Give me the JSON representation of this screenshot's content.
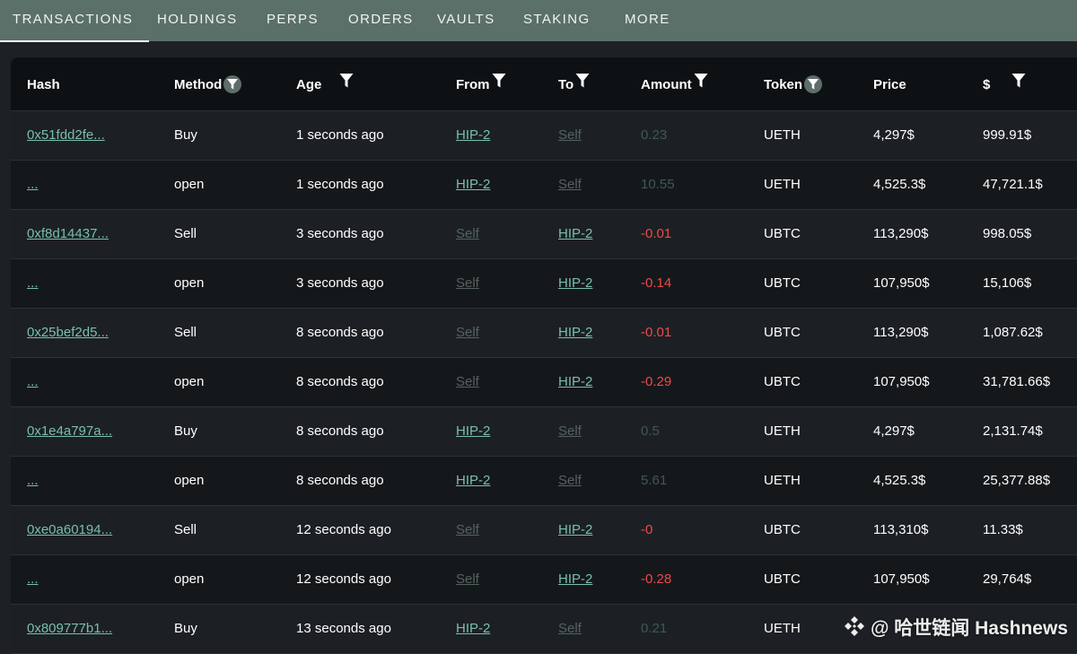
{
  "tabs": [
    {
      "label": "TRANSACTIONS",
      "active": true
    },
    {
      "label": "HOLDINGS",
      "active": false
    },
    {
      "label": "PERPS",
      "active": false
    },
    {
      "label": "ORDERS",
      "active": false
    },
    {
      "label": "VAULTS",
      "active": false
    },
    {
      "label": "STAKING",
      "active": false
    },
    {
      "label": "MORE",
      "active": false
    }
  ],
  "table": {
    "columns": [
      {
        "label": "Hash",
        "filter": "none"
      },
      {
        "label": "Method",
        "filter": "circle-filter-icon"
      },
      {
        "label": "Age",
        "filter": "filter-icon"
      },
      {
        "label": "From",
        "filter": "filter-icon"
      },
      {
        "label": "To",
        "filter": "filter-icon"
      },
      {
        "label": "Amount",
        "filter": "filter-icon"
      },
      {
        "label": "Token",
        "filter": "circle-filter-icon"
      },
      {
        "label": "Price",
        "filter": "none"
      },
      {
        "label": "$",
        "filter": "filter-icon"
      }
    ],
    "rows": [
      {
        "hash": "0x51fdd2fe...",
        "method": "Buy",
        "age": "1 seconds ago",
        "from": "HIP-2",
        "to": "Self",
        "amount": "0.23",
        "token": "UETH",
        "price": "4,297$",
        "usd": "999.91$"
      },
      {
        "hash": "...",
        "method": "open",
        "age": "1 seconds ago",
        "from": "HIP-2",
        "to": "Self",
        "amount": "10.55",
        "token": "UETH",
        "price": "4,525.3$",
        "usd": "47,721.1$"
      },
      {
        "hash": "0xf8d14437...",
        "method": "Sell",
        "age": "3 seconds ago",
        "from": "Self",
        "to": "HIP-2",
        "amount": "-0.01",
        "token": "UBTC",
        "price": "113,290$",
        "usd": "998.05$"
      },
      {
        "hash": "...",
        "method": "open",
        "age": "3 seconds ago",
        "from": "Self",
        "to": "HIP-2",
        "amount": "-0.14",
        "token": "UBTC",
        "price": "107,950$",
        "usd": "15,106$"
      },
      {
        "hash": "0x25bef2d5...",
        "method": "Sell",
        "age": "8 seconds ago",
        "from": "Self",
        "to": "HIP-2",
        "amount": "-0.01",
        "token": "UBTC",
        "price": "113,290$",
        "usd": "1,087.62$"
      },
      {
        "hash": "...",
        "method": "open",
        "age": "8 seconds ago",
        "from": "Self",
        "to": "HIP-2",
        "amount": "-0.29",
        "token": "UBTC",
        "price": "107,950$",
        "usd": "31,781.66$"
      },
      {
        "hash": "0x1e4a797a...",
        "method": "Buy",
        "age": "8 seconds ago",
        "from": "HIP-2",
        "to": "Self",
        "amount": "0.5",
        "token": "UETH",
        "price": "4,297$",
        "usd": "2,131.74$"
      },
      {
        "hash": "...",
        "method": "open",
        "age": "8 seconds ago",
        "from": "HIP-2",
        "to": "Self",
        "amount": "5.61",
        "token": "UETH",
        "price": "4,525.3$",
        "usd": "25,377.88$"
      },
      {
        "hash": "0xe0a60194...",
        "method": "Sell",
        "age": "12 seconds ago",
        "from": "Self",
        "to": "HIP-2",
        "amount": "-0",
        "token": "UBTC",
        "price": "113,310$",
        "usd": "11.33$"
      },
      {
        "hash": "...",
        "method": "open",
        "age": "12 seconds ago",
        "from": "Self",
        "to": "HIP-2",
        "amount": "-0.28",
        "token": "UBTC",
        "price": "107,950$",
        "usd": "29,764$"
      },
      {
        "hash": "0x809777b1...",
        "method": "Buy",
        "age": "13 seconds ago",
        "from": "HIP-2",
        "to": "Self",
        "amount": "0.21",
        "token": "UETH",
        "price": "",
        "usd": ""
      }
    ]
  },
  "watermark": {
    "text": "@ 哈世链闻 Hashnews",
    "logo": "diamond-logo-icon"
  },
  "colors": {
    "tabbar": "#5a7068",
    "link": "#79bfae",
    "self_link": "#556260",
    "positive_amount": "#3f5852",
    "negative_amount": "#ec4a4a"
  }
}
